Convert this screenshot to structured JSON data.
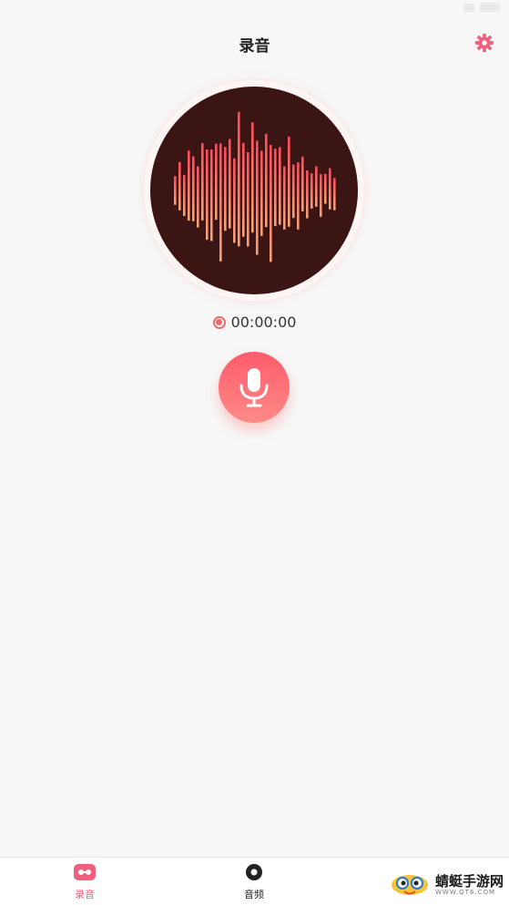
{
  "header": {
    "title": "录音"
  },
  "recorder": {
    "elapsed": "00:00:00"
  },
  "colors": {
    "accent": "#f0607a",
    "disc_background": "#3b1414",
    "wave_top": "#ff4a5c",
    "wave_bottom": "#f7a478",
    "background": "#f7f7f7"
  },
  "tabs": [
    {
      "label": "录音",
      "icon": "record-tab-icon",
      "active": true
    },
    {
      "label": "音频",
      "icon": "disc-tab-icon",
      "active": false
    }
  ],
  "watermark": {
    "brand": "蜻蜓手游网",
    "url": "WWW.QT6.COM"
  }
}
